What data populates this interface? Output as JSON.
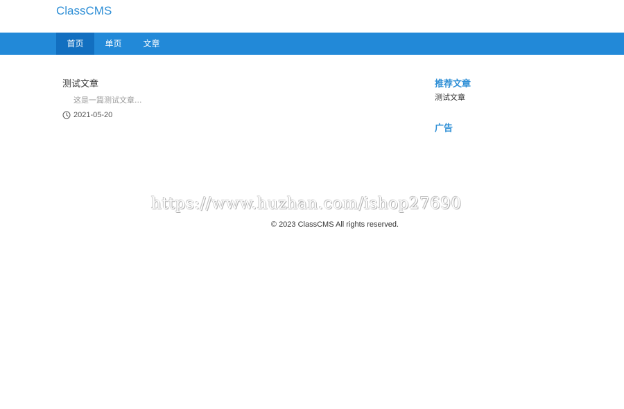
{
  "header": {
    "logo": "ClassCMS"
  },
  "nav": {
    "items": [
      {
        "label": "首页",
        "active": true
      },
      {
        "label": "单页",
        "active": false
      },
      {
        "label": "文章",
        "active": false
      }
    ]
  },
  "main": {
    "articles": [
      {
        "title": "测试文章",
        "summary": "这是一篇测试文章...",
        "date": "2021-05-20",
        "icon": "clock-icon"
      }
    ]
  },
  "sidebar": {
    "recommended_heading": "推荐文章",
    "recommended_items": [
      "测试文章"
    ],
    "ads_heading": "广告"
  },
  "watermark": "https://www.huzhan.com/ishop27690",
  "footer": {
    "copyright": "© 2023 ClassCMS All rights reserved."
  },
  "colors": {
    "accent": "#2f8fd6",
    "nav_bg": "#2289d8",
    "nav_active": "#126fc0"
  }
}
